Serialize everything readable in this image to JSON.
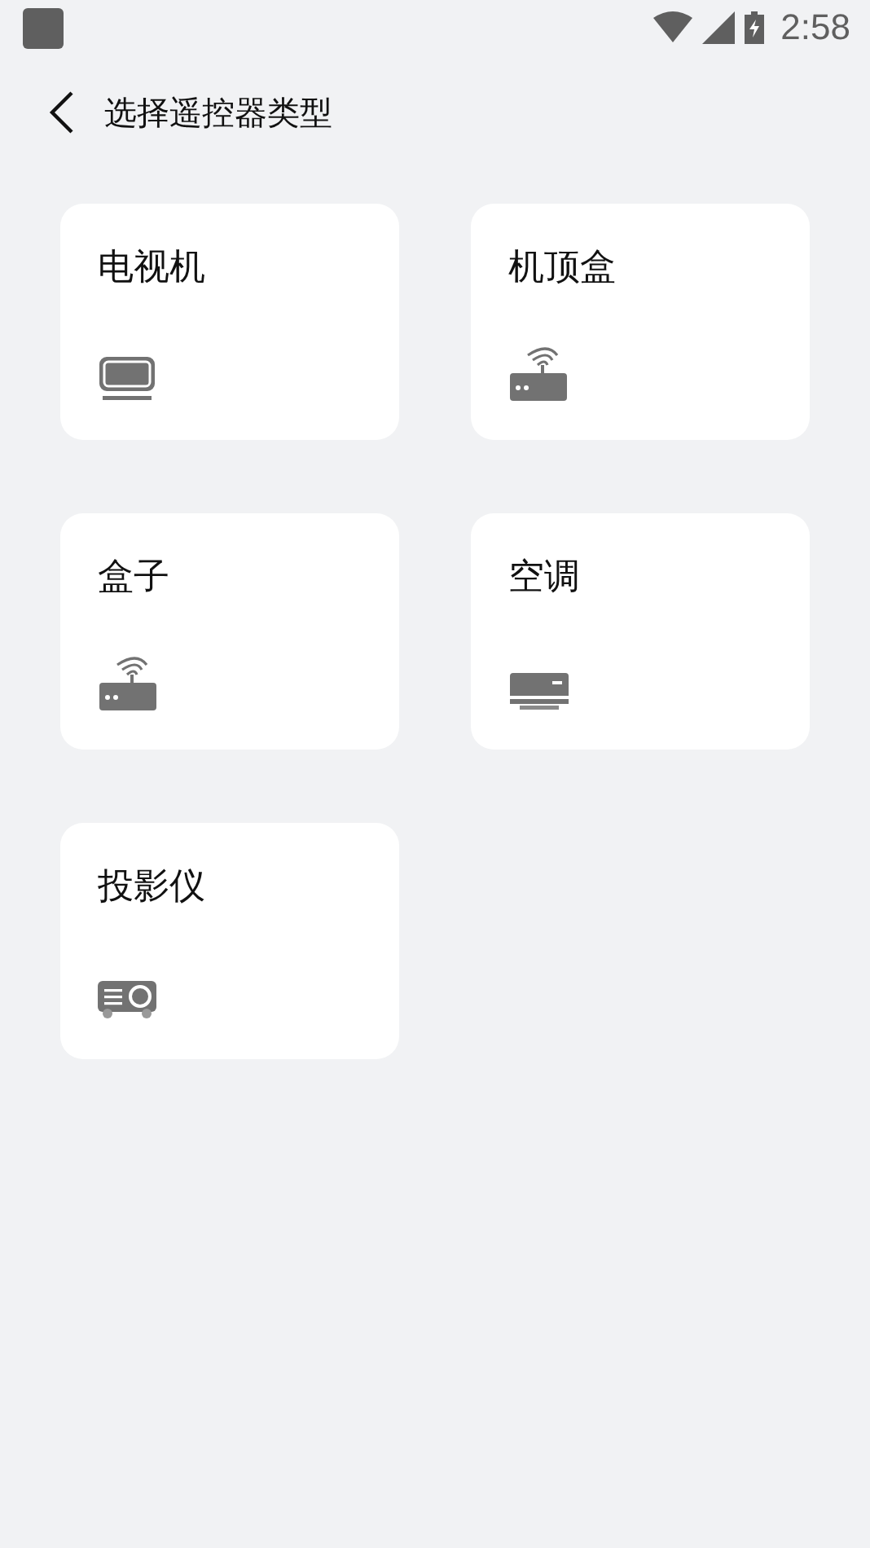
{
  "status_bar": {
    "time": "2:58"
  },
  "header": {
    "title": "选择遥控器类型"
  },
  "devices": [
    {
      "label": "电视机",
      "kind": "tv"
    },
    {
      "label": "机顶盒",
      "kind": "router"
    },
    {
      "label": "盒子",
      "kind": "router"
    },
    {
      "label": "空调",
      "kind": "ac"
    },
    {
      "label": "投影仪",
      "kind": "projector"
    }
  ]
}
